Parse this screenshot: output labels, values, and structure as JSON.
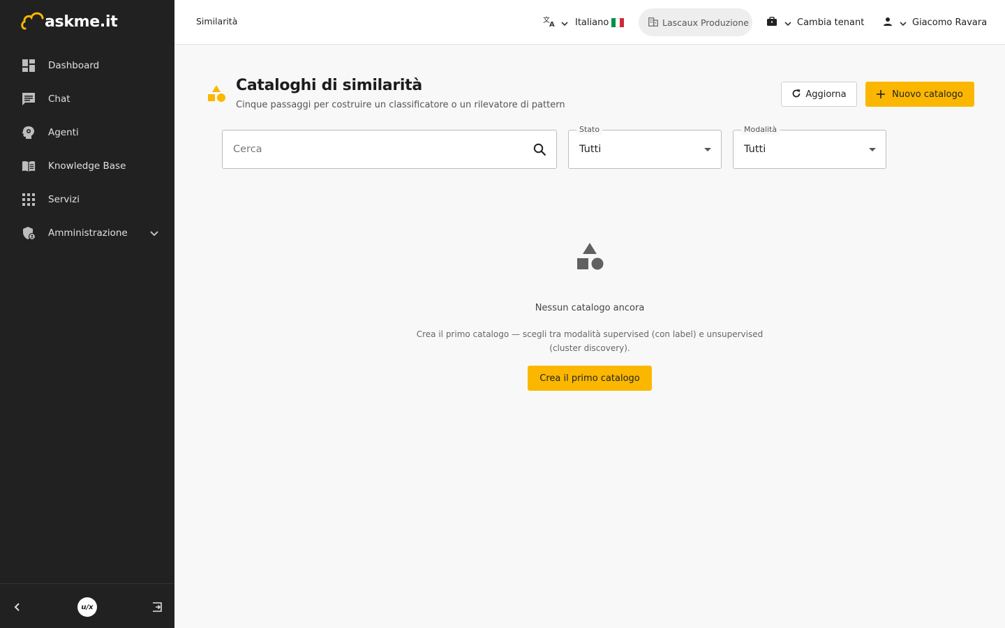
{
  "app": {
    "logo_text": "askme.it"
  },
  "sidebar": {
    "items": [
      {
        "label": "Dashboard",
        "icon": "dashboard-icon"
      },
      {
        "label": "Chat",
        "icon": "chat-icon"
      },
      {
        "label": "Agenti",
        "icon": "agent-icon"
      },
      {
        "label": "Knowledge Base",
        "icon": "book-icon"
      },
      {
        "label": "Servizi",
        "icon": "apps-grid-icon"
      },
      {
        "label": "Amministrazione",
        "icon": "admin-shield-icon"
      }
    ],
    "footer": {
      "brand_text": "u/x"
    }
  },
  "header": {
    "breadcrumb": "Similarità",
    "language": "Italiano",
    "tenant": "Lascaux Produzione",
    "switch_tenant": "Cambia tenant",
    "user": "Giacomo Ravara"
  },
  "page": {
    "title": "Cataloghi di similarità",
    "subtitle": "Cinque passaggi per costruire un classificatore o un rilevatore di pattern",
    "refresh_label": "Aggiorna",
    "new_label": "Nuovo catalogo"
  },
  "filters": {
    "search_placeholder": "Cerca",
    "state": {
      "label": "Stato",
      "value": "Tutti"
    },
    "mode": {
      "label": "Modalità",
      "value": "Tutti"
    }
  },
  "empty": {
    "title": "Nessun catalogo ancora",
    "description": "Crea il primo catalogo — scegli tra modalità supervised (con label) e unsupervised (cluster discovery).",
    "cta": "Crea il primo catalogo"
  },
  "colors": {
    "accent": "#fbb700",
    "sidebar": "#212121",
    "background": "#f8f8f8"
  }
}
